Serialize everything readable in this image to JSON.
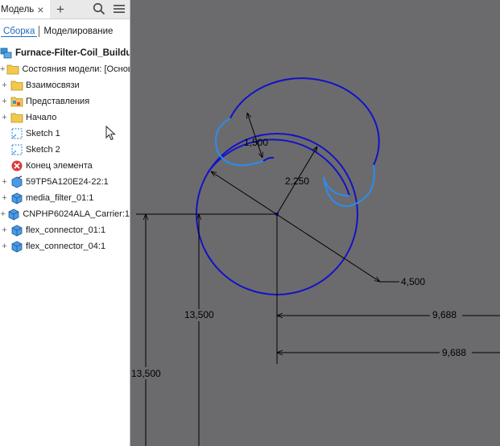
{
  "panel": {
    "tab_label": "Модель",
    "tab_close": "×",
    "add_tab": "+",
    "subtabs": [
      "Сборка",
      "Моделирование"
    ],
    "root_label": "Furnace-Filter-Coil_Buildup",
    "items": [
      {
        "label": "Состояния модели: [Основной]",
        "icon": "folder-icon",
        "expandable": true
      },
      {
        "label": "Взаимосвязи",
        "icon": "folder-icon",
        "expandable": true
      },
      {
        "label": "Представления",
        "icon": "representations-folder-icon",
        "expandable": true
      },
      {
        "label": "Начало",
        "icon": "folder-icon",
        "expandable": true
      },
      {
        "label": "Sketch 1",
        "icon": "sketch-icon",
        "expandable": false
      },
      {
        "label": "Sketch 2",
        "icon": "sketch-icon",
        "expandable": false
      },
      {
        "label": "Конец элемента",
        "icon": "end-of-part-icon",
        "expandable": false
      },
      {
        "label": "59TP5A120E24-22:1",
        "icon": "part-link-icon",
        "expandable": true
      },
      {
        "label": "media_filter_01:1",
        "icon": "part-icon",
        "expandable": true
      },
      {
        "label": "CNPHP6024ALA_Carrier:1",
        "icon": "part-icon",
        "expandable": true
      },
      {
        "label": "flex_connector_01:1",
        "icon": "part-icon",
        "expandable": true
      },
      {
        "label": "flex_connector_04:1",
        "icon": "part-icon",
        "expandable": true
      }
    ]
  },
  "canvas": {
    "dims": {
      "outer_radius": "4,500",
      "middle_radius": "2,250",
      "inner_gap": "1,500",
      "horiz_1": "9,688",
      "horiz_2": "9,688",
      "vert_1": "13,500",
      "vert_2": "13,500"
    }
  },
  "colors": {
    "viewport_bg": "#6b6b6d",
    "curve_dark": "#1212c8",
    "curve_light": "#2b8cf0",
    "dim_line": "#000000"
  }
}
